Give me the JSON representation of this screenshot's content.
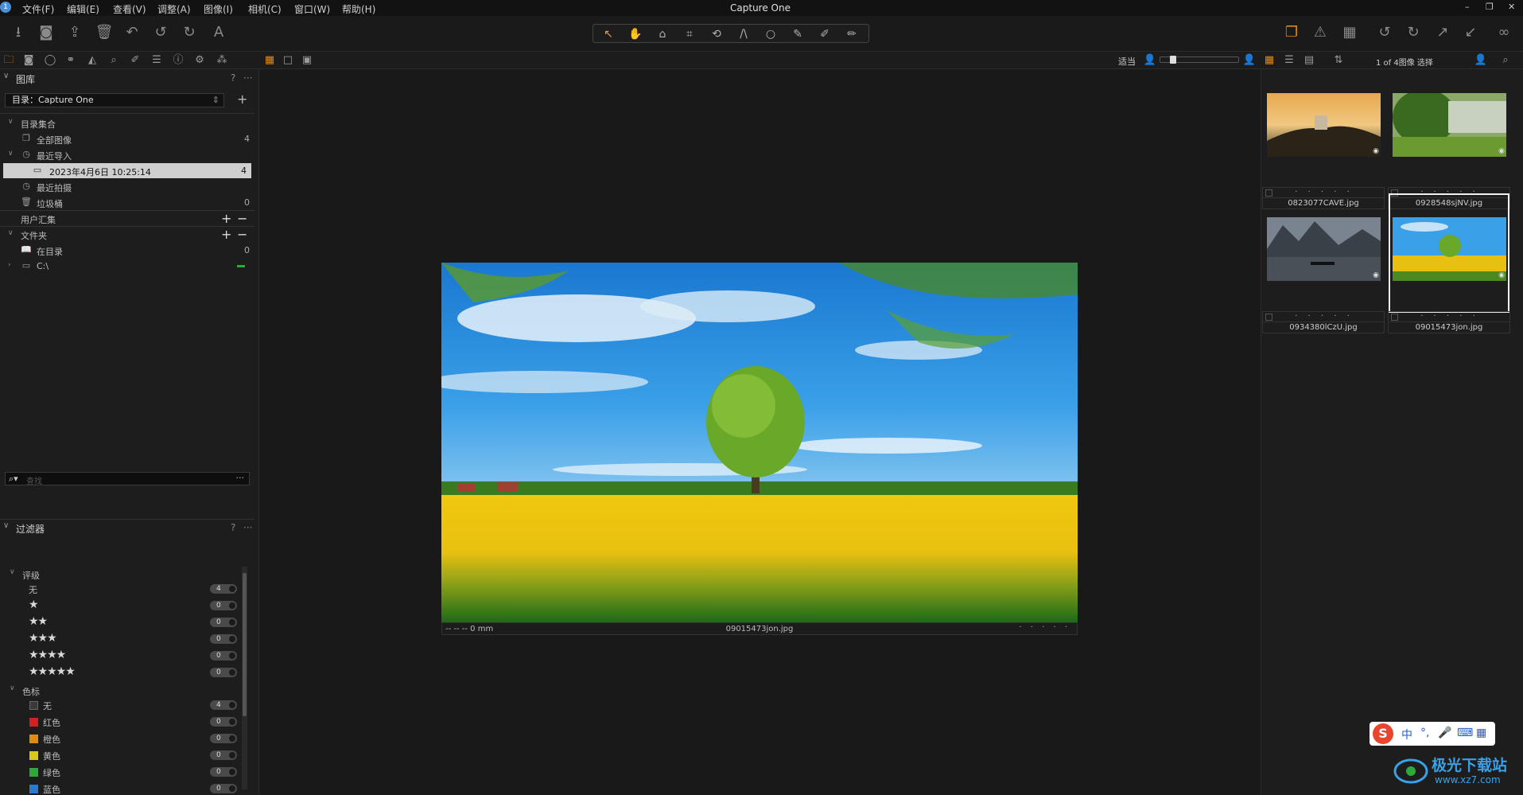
{
  "menubar": {
    "app_logo": "1",
    "items": [
      "文件(F)",
      "编辑(E)",
      "查看(V)",
      "调整(A)",
      "图像(I)",
      "相机(C)",
      "窗口(W)",
      "帮助(H)"
    ],
    "title": "Capture One",
    "window_controls": [
      "–",
      "❐",
      "✕"
    ]
  },
  "toolbar": {
    "left_icons": [
      "import-icon",
      "camera-icon",
      "export-icon",
      "trash-icon",
      "undo-history-icon",
      "undo-icon",
      "redo-icon",
      "text-icon"
    ],
    "cursor_tools": [
      "select-icon",
      "pan-icon",
      "loupe-icon",
      "crop-icon",
      "rotate-icon",
      "keystone-icon",
      "spot-icon",
      "brush-icon",
      "picker-icon",
      "eraser-icon"
    ],
    "right_icons": [
      "stack-icon",
      "warning-icon",
      "grid-icon",
      "rotate-left-icon",
      "rotate-right-icon",
      "expand-icon",
      "collapse-icon",
      "glasses-icon"
    ]
  },
  "subbar": {
    "zoom_label": "适当",
    "browser_info": "1 of 4图像 选择"
  },
  "library": {
    "title": "图库",
    "help": "?",
    "more": "···",
    "catalog_value": "目录：Capture One",
    "tree": [
      {
        "label": "目录集合",
        "count": ""
      },
      {
        "label": "全部图像",
        "count": "4"
      },
      {
        "label": "最近导入",
        "count": ""
      },
      {
        "label": "2023年4月6日 10:25:14",
        "count": "4"
      },
      {
        "label": "最近拍摄",
        "count": ""
      },
      {
        "label": "垃圾桶",
        "count": "0"
      },
      {
        "label": "用户汇集",
        "count": ""
      },
      {
        "label": "文件夹",
        "count": ""
      },
      {
        "label": "在目录",
        "count": "0"
      },
      {
        "label": "C:\\",
        "count": ""
      }
    ]
  },
  "filters": {
    "title": "过滤器",
    "help": "?",
    "more": "···",
    "search_placeholder": "查找",
    "rating_group": "评级",
    "ratings": [
      {
        "label": "无",
        "count": "4"
      },
      {
        "label": "★",
        "count": "0"
      },
      {
        "label": "★★",
        "count": "0"
      },
      {
        "label": "★★★",
        "count": "0"
      },
      {
        "label": "★★★★",
        "count": "0"
      },
      {
        "label": "★★★★★",
        "count": "0"
      }
    ],
    "color_group": "色标",
    "colors": [
      {
        "label": "无",
        "count": "4",
        "color": "#3a3a3a"
      },
      {
        "label": "红色",
        "count": "0",
        "color": "#d42020"
      },
      {
        "label": "橙色",
        "count": "0",
        "color": "#e08a18"
      },
      {
        "label": "黄色",
        "count": "0",
        "color": "#d8c818"
      },
      {
        "label": "绿色",
        "count": "0",
        "color": "#2ea838"
      },
      {
        "label": "蓝色",
        "count": "0",
        "color": "#2a78d8"
      }
    ]
  },
  "viewer": {
    "caption_left": "-- -- -- 0 mm",
    "caption_center": "09015473jon.jpg",
    "caption_right": "· · · · ·"
  },
  "browser": {
    "thumbnails": [
      {
        "filename": "0823077CAVE.jpg",
        "dots": "· · · · ·"
      },
      {
        "filename": "0928548sjNV.jpg",
        "dots": "· · · · ·"
      },
      {
        "filename": "0934380lCzU.jpg",
        "dots": "· · · · ·"
      },
      {
        "filename": "09015473jon.jpg",
        "dots": "· · · · ·"
      }
    ]
  },
  "ime": {
    "s": "S",
    "items": [
      "中",
      "°,",
      "🎤",
      "⌨",
      "▦"
    ]
  },
  "watermark": {
    "line1": "极光下载站",
    "line2": "www.xz7.com"
  }
}
